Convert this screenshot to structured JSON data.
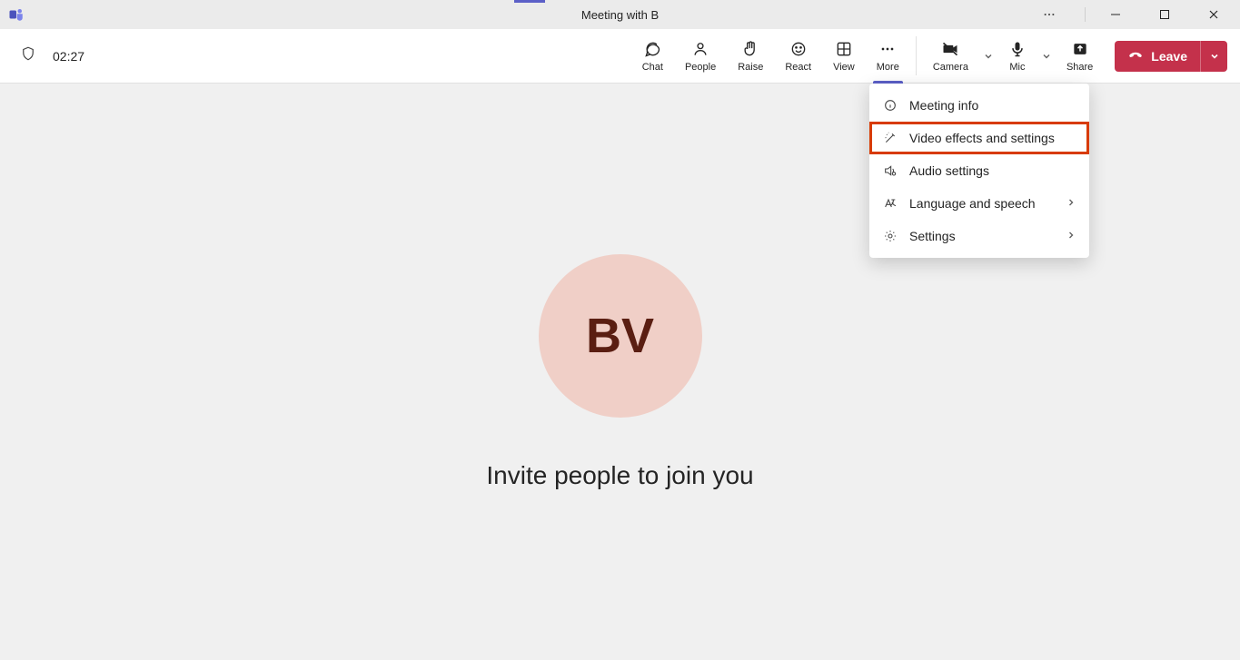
{
  "window": {
    "title": "Meeting with B"
  },
  "timer": "02:27",
  "toolbar": {
    "chat": "Chat",
    "people": "People",
    "raise": "Raise",
    "react": "React",
    "view": "View",
    "more": "More",
    "camera": "Camera",
    "mic": "Mic",
    "share": "Share"
  },
  "leave": {
    "label": "Leave"
  },
  "dropdown": {
    "meeting_info": "Meeting info",
    "video_effects": "Video effects and settings",
    "audio_settings": "Audio settings",
    "language_speech": "Language and speech",
    "settings": "Settings"
  },
  "stage": {
    "avatar_initials": "BV",
    "invite_text": "Invite people to join you"
  }
}
